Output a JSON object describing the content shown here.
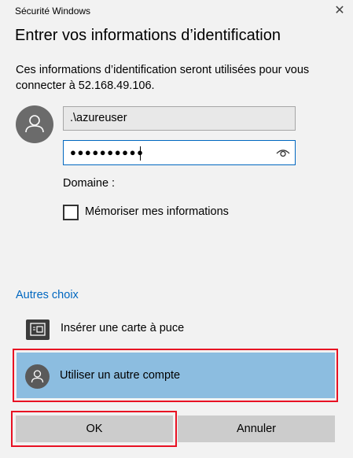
{
  "window": {
    "title": "Sécurité Windows",
    "close_glyph": "✕"
  },
  "dialog": {
    "heading": "Entrer vos informations d’identification",
    "description": "Ces informations d’identification seront utilisées pour vous connecter à  52.168.49.106."
  },
  "credentials": {
    "username": ".\\azureuser",
    "password_mask": "●●●●●●●●●●",
    "domain_label": "Domaine :",
    "remember_label": "Mémoriser mes informations",
    "remember_checked": false
  },
  "choices": {
    "heading": "Autres choix",
    "items": [
      {
        "label": "Insérer une carte à puce",
        "icon": "smartcard-icon"
      },
      {
        "label": "Utiliser un autre compte",
        "icon": "user-avatar-icon",
        "selected": true
      }
    ]
  },
  "buttons": {
    "ok": "OK",
    "cancel": "Annuler"
  },
  "colors": {
    "accent": "#0067c0",
    "selected_row": "#8cbde0",
    "highlight_outline": "#e81123",
    "background": "#f2f2f2"
  }
}
